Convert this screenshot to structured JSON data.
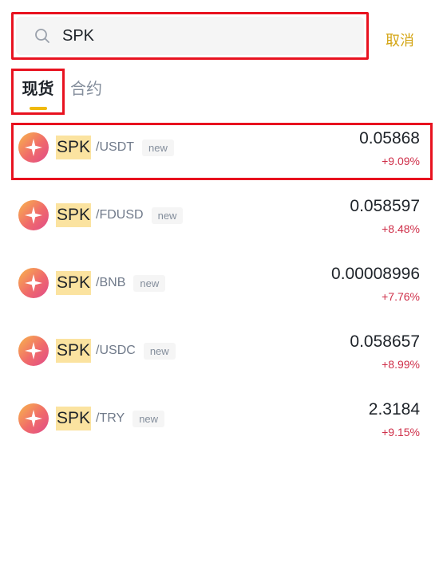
{
  "search": {
    "value": "SPK",
    "placeholder": "",
    "cancel_label": "取消"
  },
  "tabs": [
    {
      "label": "现货",
      "active": true
    },
    {
      "label": "合约",
      "active": false
    }
  ],
  "rows": [
    {
      "base": "SPK",
      "quote": "/USDT",
      "badge": "new",
      "price": "0.05868",
      "change": "+9.09%"
    },
    {
      "base": "SPK",
      "quote": "/FDUSD",
      "badge": "new",
      "price": "0.058597",
      "change": "+8.48%"
    },
    {
      "base": "SPK",
      "quote": "/BNB",
      "badge": "new",
      "price": "0.00008996",
      "change": "+7.76%"
    },
    {
      "base": "SPK",
      "quote": "/USDC",
      "badge": "new",
      "price": "0.058657",
      "change": "+8.99%"
    },
    {
      "base": "SPK",
      "quote": "/TRY",
      "badge": "new",
      "price": "2.3184",
      "change": "+9.15%"
    }
  ],
  "colors": {
    "accent": "#f0b90b",
    "cancel": "#d4a514",
    "up": "#cf304a",
    "highlight": "#e8121f"
  },
  "icons": {
    "search": "search-icon",
    "coin": "spk-coin-icon"
  }
}
